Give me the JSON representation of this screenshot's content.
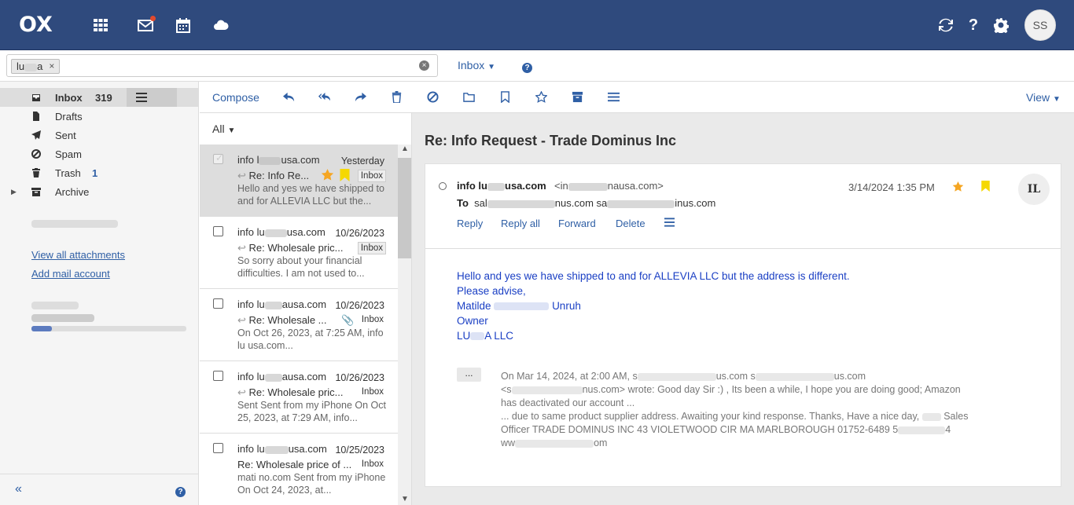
{
  "topbar": {
    "logo": "OX",
    "icons": [
      "apps-grid-icon",
      "mail-icon",
      "calendar-icon",
      "drive-cloud-icon",
      "refresh-icon",
      "help-icon",
      "settings-gear-icon"
    ],
    "avatar_initials": "SS"
  },
  "search": {
    "token_left": "lu",
    "token_right": "a",
    "token_remove": "×",
    "clear": "×",
    "folder_dropdown": "Inbox",
    "help": "?"
  },
  "sidebar": {
    "folders": [
      {
        "label": "Inbox",
        "count": "319",
        "icon": "inbox-icon"
      },
      {
        "label": "Drafts",
        "count": "",
        "icon": "drafts-icon"
      },
      {
        "label": "Sent",
        "count": "",
        "icon": "sent-icon"
      },
      {
        "label": "Spam",
        "count": "",
        "icon": "spam-icon"
      },
      {
        "label": "Trash",
        "count": "1",
        "icon": "trash-icon"
      },
      {
        "label": "Archive",
        "count": "",
        "icon": "archive-icon"
      }
    ],
    "view_attachments": "View all attachments",
    "add_mail_account": "Add mail account",
    "collapse": "«",
    "help": "?"
  },
  "toolbar": {
    "compose": "Compose",
    "view": "View",
    "icons": [
      "reply-icon",
      "reply-all-icon",
      "forward-icon",
      "delete-icon",
      "spam-icon",
      "move-icon",
      "flag-icon",
      "star-icon",
      "archive-icon",
      "more-icon"
    ]
  },
  "list": {
    "filter": "All",
    "mails": [
      {
        "from_a": "info l",
        "from_b": "usa.com",
        "date": "Yesterday",
        "subject": "Re: Info Re...",
        "folder": "Inbox",
        "preview": "Hello and yes we have shipped to and for ALLEVIA LLC but the..."
      },
      {
        "from_a": "info lu",
        "from_b": "usa.com",
        "date": "10/26/2023",
        "subject": "Re: Wholesale pric...",
        "folder": "Inbox",
        "preview": "So sorry about your financial difficulties. I am not used to..."
      },
      {
        "from_a": "info lu",
        "from_b": "ausa.com",
        "date": "10/26/2023",
        "subject": "Re: Wholesale ...",
        "folder": "Inbox",
        "preview": "On Oct 26, 2023, at 7:25 AM, info lu          usa.com..."
      },
      {
        "from_a": "info lu",
        "from_b": "ausa.com",
        "date": "10/26/2023",
        "subject": "Re: Wholesale pric...",
        "folder": "Inbox",
        "preview": "Sent Sent from my iPhone On Oct 25, 2023, at 7:29 AM, info..."
      },
      {
        "from_a": "info lu",
        "from_b": "usa.com",
        "date": "10/25/2023",
        "subject": "Re: Wholesale price of ...",
        "folder": "Inbox",
        "preview": "mati           no.com Sent from my iPhone On Oct 24, 2023, at..."
      }
    ]
  },
  "detail": {
    "subject": "Re: Info Request - Trade Dominus Inc",
    "sender_a": "info lu",
    "sender_b": "usa.com",
    "sender_addr_a": "<in",
    "sender_addr_b": "nausa.com>",
    "to_label": "To",
    "to_a": "sal",
    "to_b": "nus.com",
    "to_c": "sa",
    "to_d": "inus.com",
    "timestamp": "3/14/2024 1:35 PM",
    "avatar": "IL",
    "actions": [
      "Reply",
      "Reply all",
      "Forward",
      "Delete"
    ],
    "body": {
      "line1": "Hello and yes we have shipped to and for ALLEVIA LLC but the address is different.",
      "line2": "Please advise,",
      "line3_a": "Matilde",
      "line3_b": "Unruh",
      "line4": "Owner",
      "line5_a": "LU",
      "line5_b": "A LLC"
    },
    "quote_toggle": "...",
    "quote": {
      "l1_a": "On Mar 14, 2024, at 2:00 AM, s",
      "l1_b": "us.com",
      "l1_c": "s",
      "l1_d": "us.com",
      "l2_a": "<s",
      "l2_b": "nus.com> wrote: Good day Sir :) , Its been a while, I hope you are doing good; Amazon",
      "l3": "has deactivated our account ...",
      "l4_a": "... due to same product supplier address. Awaiting your kind response. Thanks, Have a nice day,",
      "l4_b": "Sales",
      "l5_a": "Officer TRADE DOMINUS INC 43 VIOLETWOOD CIR MA MARLBOROUGH 01752-6489 5",
      "l5_b": "4",
      "l6_a": "ww",
      "l6_b": "om"
    }
  },
  "colors": {
    "topbar": "#2f4a7d",
    "accent": "#2f5fa5",
    "star": "#f5a623",
    "flag": "#f5d800",
    "unread_dot": "#e14a2e"
  }
}
